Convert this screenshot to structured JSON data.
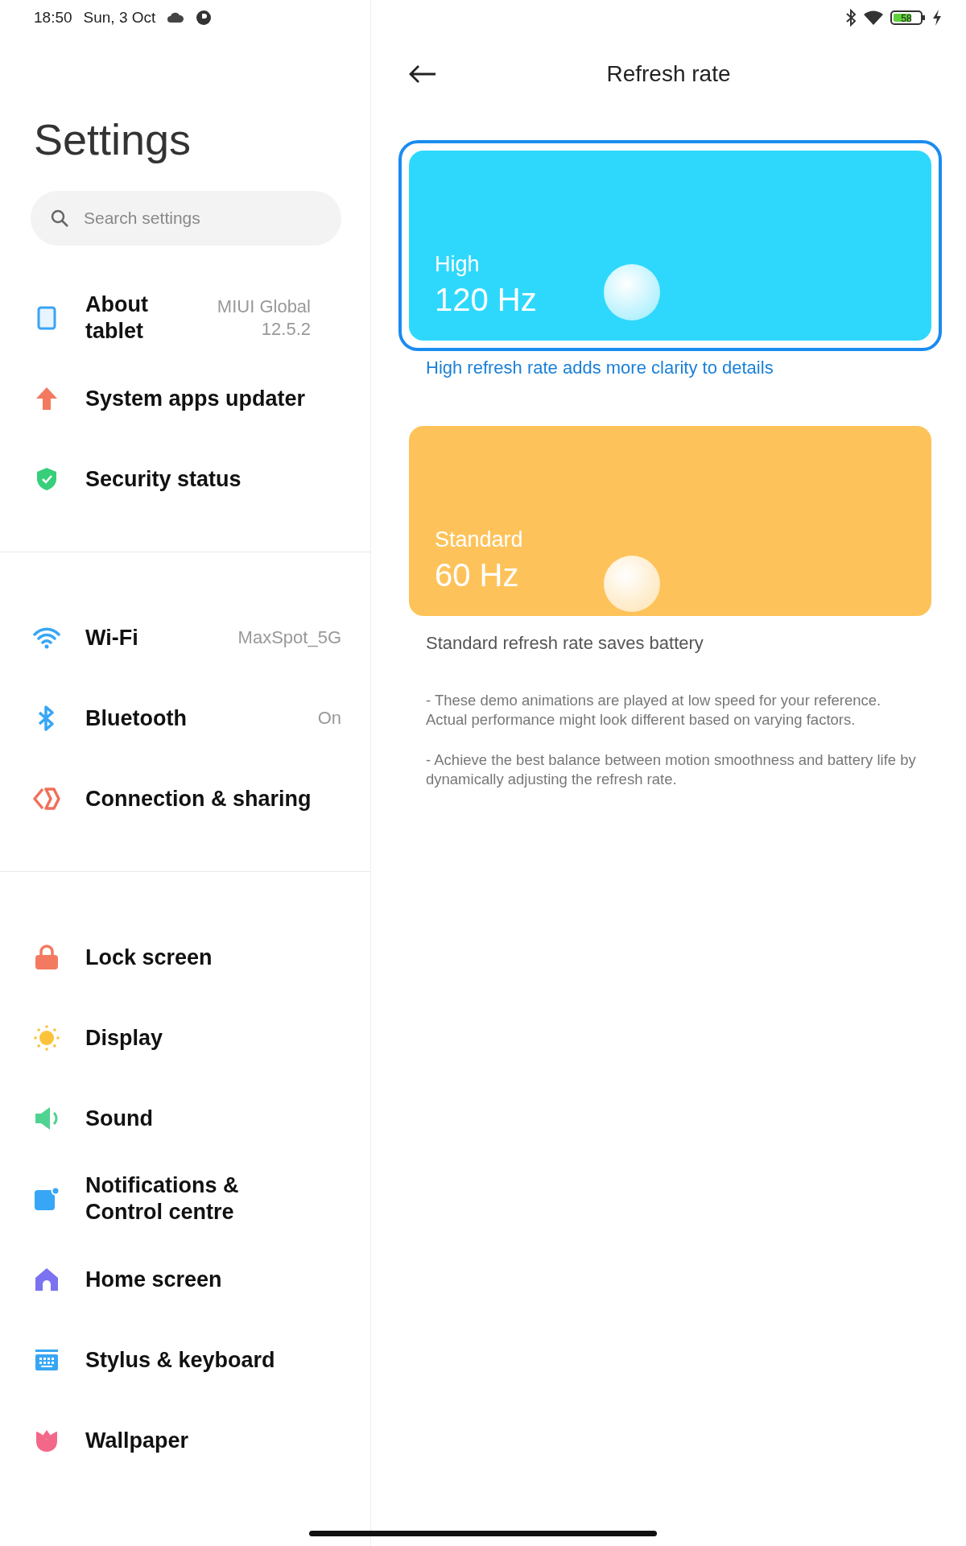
{
  "status_bar": {
    "time": "18:50",
    "date": "Sun, 3 Oct",
    "battery": "58"
  },
  "sidebar": {
    "title": "Settings",
    "search": {
      "placeholder": "Search settings"
    },
    "groups": [
      {
        "items": [
          {
            "label": "About tablet",
            "value": "MIUI Global 12.5.2"
          },
          {
            "label": "System apps updater"
          },
          {
            "label": "Security status"
          }
        ]
      },
      {
        "items": [
          {
            "label": "Wi-Fi",
            "value": "MaxSpot_5G"
          },
          {
            "label": "Bluetooth",
            "value": "On"
          },
          {
            "label": "Connection & sharing"
          }
        ]
      },
      {
        "items": [
          {
            "label": "Lock screen"
          },
          {
            "label": "Display"
          },
          {
            "label": "Sound"
          },
          {
            "label": "Notifications & Control centre"
          },
          {
            "label": "Home screen"
          },
          {
            "label": "Stylus & keyboard"
          },
          {
            "label": "Wallpaper"
          }
        ]
      }
    ]
  },
  "detail": {
    "title": "Refresh rate",
    "options": [
      {
        "name": "High",
        "rate": "120 Hz",
        "description": "High refresh rate adds more clarity to details",
        "color": "#2ed8fc",
        "selected": true
      },
      {
        "name": "Standard",
        "rate": "60 Hz",
        "description": "Standard refresh rate saves battery",
        "color": "#fdc35a",
        "selected": false
      }
    ],
    "notes": [
      "- These demo animations are played at low speed for your reference. Actual performance might look different based on varying factors.",
      "- Achieve the best balance between motion smoothness and battery life by dynamically adjusting the refresh rate."
    ]
  }
}
